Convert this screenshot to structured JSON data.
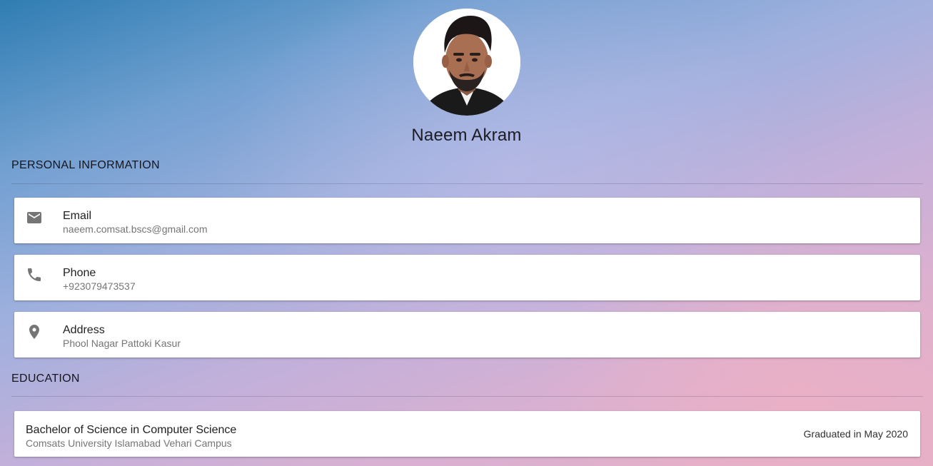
{
  "profile": {
    "name": "Naeem Akram",
    "avatar_icon": "profile-photo"
  },
  "personal_info": {
    "heading": "PERSONAL INFORMATION",
    "items": [
      {
        "icon": "email-icon",
        "label": "Email",
        "value": "naeem.comsat.bscs@gmail.com"
      },
      {
        "icon": "phone-icon",
        "label": "Phone",
        "value": "+923079473537"
      },
      {
        "icon": "location-pin-icon",
        "label": "Address",
        "value": "Phool Nagar Pattoki Kasur"
      }
    ]
  },
  "education": {
    "heading": "EDUCATION",
    "items": [
      {
        "degree": "Bachelor of Science in Computer Science",
        "institution": "Comsats University Islamabad Vehari Campus",
        "status": "Graduated in May 2020"
      }
    ]
  },
  "colors": {
    "icon_grey": "#757575",
    "card_bg": "#ffffff",
    "text_primary": "#212121",
    "text_secondary": "#757575"
  }
}
